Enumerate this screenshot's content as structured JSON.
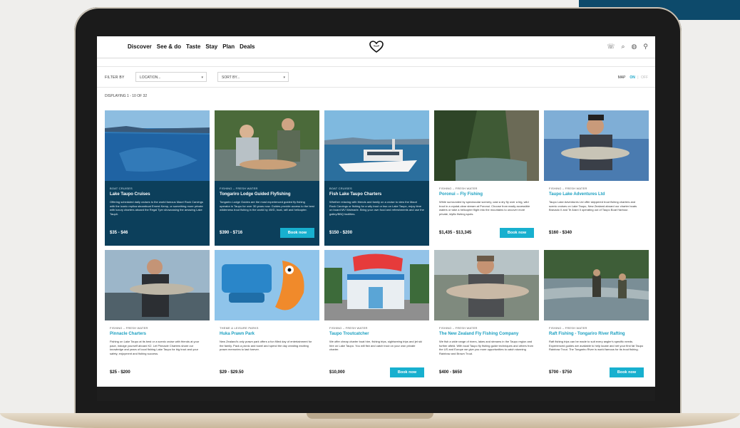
{
  "nav": {
    "links": [
      "Discover",
      "See & do",
      "Taste",
      "Stay",
      "Plan",
      "Deals"
    ],
    "icons": [
      "phone-icon",
      "search-icon",
      "globe-icon",
      "location-pin-icon"
    ]
  },
  "filter": {
    "label": "FILTER BY",
    "location_placeholder": "LOCATION...",
    "sort_placeholder": "SORT BY...",
    "map_label": "MAP",
    "map_on": "ON",
    "map_separator": "|",
    "map_off": "OFF"
  },
  "results": {
    "displaying": "DISPLAYING 1 - 10 OF 32"
  },
  "book_label": "Book now",
  "colors": {
    "accent": "#18b0cf",
    "dark_card": "#0c3f5b",
    "brand_band": "#0d4a6b"
  },
  "cards": [
    {
      "category": "BOAT CRUISES",
      "title": "Lake Taupo Cruises",
      "description": "Offering scheduled daily cruises to the world famous Maori Rock Carvings with the iconic replica steamboat Ernest Kemp, or something more private with luxury charters aboard the Regal Tyer showcasing the amazing Lake Taupō.",
      "price": "$35 - $46",
      "has_button": false,
      "dark": true
    },
    {
      "category": "FISHING – FRESH WATER",
      "title": "Tongariro Lodge Guided Flyfishing",
      "description": "Tongariro Lodge Guides are the most experienced guided fly fishing operator in Taupo for over 30 years now. Guides provide access to the best wilderness trout fishing in the world by 4WD, boat, raft and helicopter.",
      "price": "$390 - $716",
      "has_button": true,
      "dark": true
    },
    {
      "category": "BOAT CRUISES",
      "title": "Fish Lake Taupo Charters",
      "description": "Whether relaxing with friends and family on a cruise to view the Maori Rock Carvings or fishing for a wily trout or two on Lake Taupo, enjoy time on board MV Waimarie. Bring your own food and refreshments and use the galley/BBQ facilities.",
      "price": "$150 - $200",
      "has_button": false,
      "dark": true
    },
    {
      "category": "FISHING – FRESH WATER",
      "title": "Poronui – Fly Fishing",
      "description": "While surrounded by spectacular scenery, cast a dry fly over a big, wild trout in a crystal-clear stream at Poronui. Choose from easily accessible waters or take a helicopter flight into the mountains to uncover more private, idyllic fishing spots.",
      "price": "$1,435 - $13,345",
      "has_button": true,
      "dark": false
    },
    {
      "category": "FISHING – FRESH WATER",
      "title": "Taupo Lake Adventures Ltd",
      "description": "Taupo Lake Adventures Ltd offer skippered trout fishing charters and scenic cruises on Lake Taupo, New Zealand aboard our charter boats Bravado II and Te Arani II operating out of Taupo Boat Harbour.",
      "price": "$160 - $340",
      "has_button": false,
      "dark": false
    },
    {
      "category": "FISHING – FRESH WATER",
      "title": "Pinnacle Charters",
      "description": "Fishing on Lake Taupo at its best or a scenic cruise with friends at your pace, indulge yourself aboard K2. Let Pinnacle Charters share our knowledge and years of local fishing Lake Taupo for big trout and your safety, enjoyment and fishing success.",
      "price": "$25 - $200",
      "has_button": false,
      "dark": false
    },
    {
      "category": "THEME & LEISURE PARKS",
      "title": "Huka Prawn Park",
      "description": "New Zealand's only prawn park offers a fun filled day of entertainment for the family. Pack a picnic and towel and spend the day creating exciting prawn memories to last forever.",
      "price": "$29 - $29.50",
      "has_button": false,
      "dark": false
    },
    {
      "category": "FISHING – FRESH WATER",
      "title": "Taupo Troutcatcher",
      "description": "We offer cheap charter boat hire, fishing trips, sightseeing trips and jet ski hire on Lake Taupo. You will fish and catch trout on your own private charter.",
      "price": "$10,000",
      "has_button": true,
      "dark": false
    },
    {
      "category": "FISHING – FRESH WATER",
      "title": "The New Zealand Fly Fishing Company",
      "description": "We fish a wide range of rivers, lakes and streams in the Taupo region and further afield. With local Taupo fly fishing guide techniques and others from the US and Europe we give you more opportunities to catch stunning Rainbow and Brown Trout.",
      "price": "$400 - $650",
      "has_button": false,
      "dark": false
    },
    {
      "category": "FISHING – FRESH WATER",
      "title": "Raft Fishing - Tongariro River Rafting",
      "description": "Raft fishing trips can be made to suit every angler's specific needs. Experienced guides are available to help locate and net your first fat Taupo Rainbow Trout. The Tongariro River is world famous for its trout fishing.",
      "price": "$700 - $750",
      "has_button": true,
      "dark": false
    }
  ]
}
